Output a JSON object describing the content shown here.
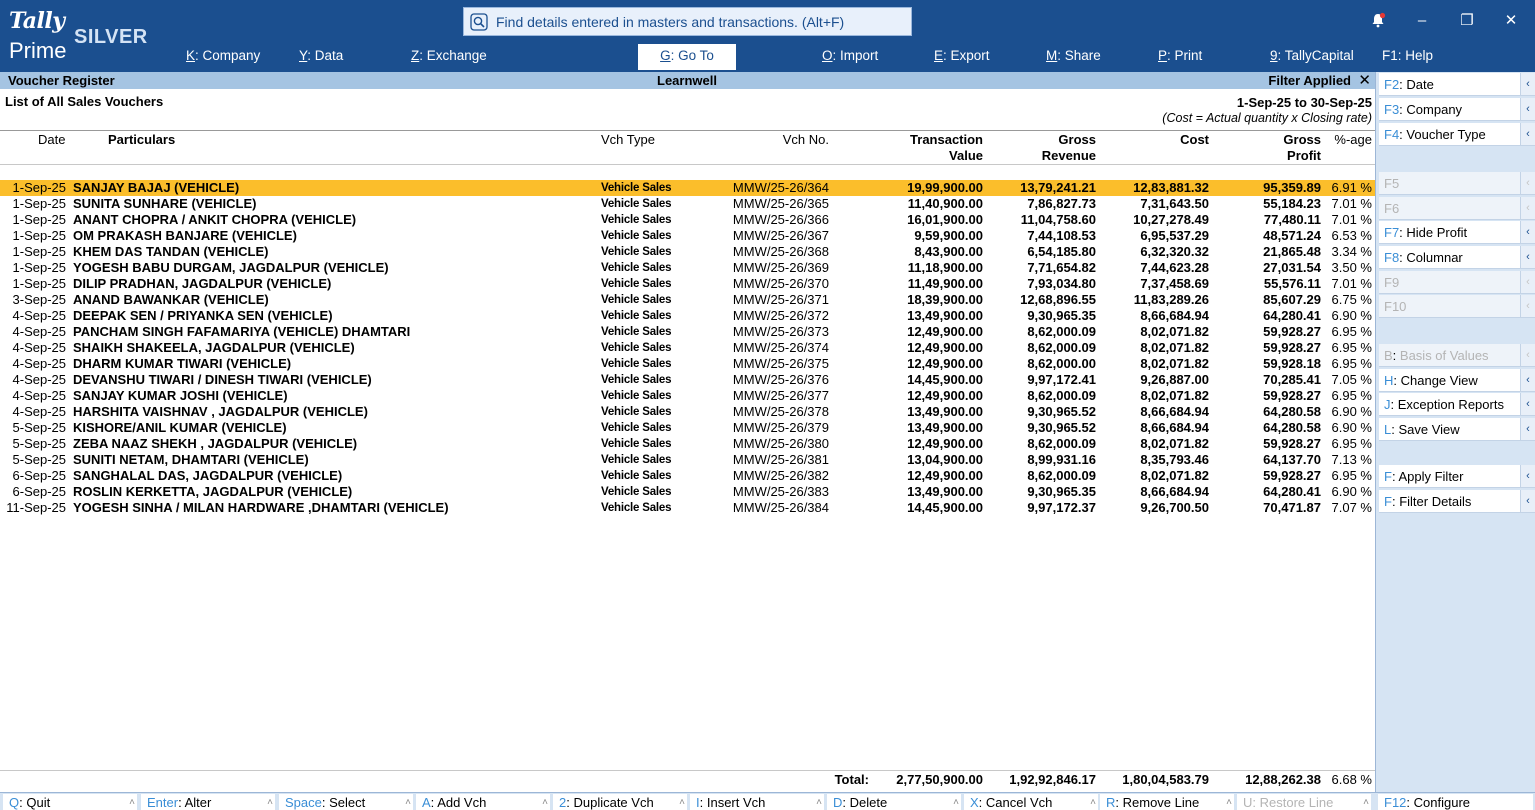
{
  "app": {
    "logo_line1": "Tally",
    "logo_line2": "Prime",
    "edition": "SILVER",
    "search_placeholder": "Find details entered in masters and transactions. (Alt+F)"
  },
  "menu": [
    {
      "key": "K",
      "label": "Company"
    },
    {
      "key": "Y",
      "label": "Data"
    },
    {
      "key": "Z",
      "label": "Exchange"
    },
    {
      "key": "G",
      "label": "Go To"
    },
    {
      "key": "O",
      "label": "Import"
    },
    {
      "key": "E",
      "label": "Export"
    },
    {
      "key": "M",
      "label": "Share"
    },
    {
      "key": "P",
      "label": "Print"
    },
    {
      "key": "9",
      "label": "TallyCapital"
    },
    {
      "key": "F1",
      "label": "Help"
    }
  ],
  "report": {
    "name": "Voucher Register",
    "company": "Learnwell",
    "filter_status": "Filter Applied",
    "title": "List of All Sales Vouchers",
    "period": "1-Sep-25 to 30-Sep-25",
    "cost_note": "(Cost = Actual quantity x Closing rate)"
  },
  "columns": {
    "date": "Date",
    "particulars": "Particulars",
    "vch_type": "Vch Type",
    "vch_no": "Vch No.",
    "transaction_value_1": "Transaction",
    "transaction_value_2": "Value",
    "gross_revenue_1": "Gross",
    "gross_revenue_2": "Revenue",
    "cost": "Cost",
    "gross_profit_1": "Gross",
    "gross_profit_2": "Profit",
    "pct": "%-age"
  },
  "rows": [
    {
      "date": "1-Sep-25",
      "particulars": "SANJAY BAJAJ (VEHICLE)",
      "vch_type": "Vehicle Sales",
      "vch_no": "MMW/25-26/364",
      "tv": "19,99,900.00",
      "gr": "13,79,241.21",
      "cost": "12,83,881.32",
      "gp": "95,359.89",
      "pct": "6.91 %"
    },
    {
      "date": "1-Sep-25",
      "particulars": "SUNITA SUNHARE (VEHICLE)",
      "vch_type": "Vehicle Sales",
      "vch_no": "MMW/25-26/365",
      "tv": "11,40,900.00",
      "gr": "7,86,827.73",
      "cost": "7,31,643.50",
      "gp": "55,184.23",
      "pct": "7.01 %"
    },
    {
      "date": "1-Sep-25",
      "particulars": "ANANT CHOPRA / ANKIT CHOPRA (VEHICLE)",
      "vch_type": "Vehicle Sales",
      "vch_no": "MMW/25-26/366",
      "tv": "16,01,900.00",
      "gr": "11,04,758.60",
      "cost": "10,27,278.49",
      "gp": "77,480.11",
      "pct": "7.01 %"
    },
    {
      "date": "1-Sep-25",
      "particulars": "OM PRAKASH BANJARE (VEHICLE)",
      "vch_type": "Vehicle Sales",
      "vch_no": "MMW/25-26/367",
      "tv": "9,59,900.00",
      "gr": "7,44,108.53",
      "cost": "6,95,537.29",
      "gp": "48,571.24",
      "pct": "6.53 %"
    },
    {
      "date": "1-Sep-25",
      "particulars": "KHEM DAS TANDAN (VEHICLE)",
      "vch_type": "Vehicle Sales",
      "vch_no": "MMW/25-26/368",
      "tv": "8,43,900.00",
      "gr": "6,54,185.80",
      "cost": "6,32,320.32",
      "gp": "21,865.48",
      "pct": "3.34 %"
    },
    {
      "date": "1-Sep-25",
      "particulars": "YOGESH BABU DURGAM, JAGDALPUR (VEHICLE)",
      "vch_type": "Vehicle Sales",
      "vch_no": "MMW/25-26/369",
      "tv": "11,18,900.00",
      "gr": "7,71,654.82",
      "cost": "7,44,623.28",
      "gp": "27,031.54",
      "pct": "3.50 %"
    },
    {
      "date": "1-Sep-25",
      "particulars": "DILIP PRADHAN, JAGDALPUR (VEHICLE)",
      "vch_type": "Vehicle Sales",
      "vch_no": "MMW/25-26/370",
      "tv": "11,49,900.00",
      "gr": "7,93,034.80",
      "cost": "7,37,458.69",
      "gp": "55,576.11",
      "pct": "7.01 %"
    },
    {
      "date": "3-Sep-25",
      "particulars": "ANAND BAWANKAR (VEHICLE)",
      "vch_type": "Vehicle Sales",
      "vch_no": "MMW/25-26/371",
      "tv": "18,39,900.00",
      "gr": "12,68,896.55",
      "cost": "11,83,289.26",
      "gp": "85,607.29",
      "pct": "6.75 %"
    },
    {
      "date": "4-Sep-25",
      "particulars": "DEEPAK SEN / PRIYANKA SEN (VEHICLE)",
      "vch_type": "Vehicle Sales",
      "vch_no": "MMW/25-26/372",
      "tv": "13,49,900.00",
      "gr": "9,30,965.35",
      "cost": "8,66,684.94",
      "gp": "64,280.41",
      "pct": "6.90 %"
    },
    {
      "date": "4-Sep-25",
      "particulars": "PANCHAM SINGH FAFAMARIYA (VEHICLE) DHAMTARI",
      "vch_type": "Vehicle Sales",
      "vch_no": "MMW/25-26/373",
      "tv": "12,49,900.00",
      "gr": "8,62,000.09",
      "cost": "8,02,071.82",
      "gp": "59,928.27",
      "pct": "6.95 %"
    },
    {
      "date": "4-Sep-25",
      "particulars": "SHAIKH SHAKEELA, JAGDALPUR (VEHICLE)",
      "vch_type": "Vehicle Sales",
      "vch_no": "MMW/25-26/374",
      "tv": "12,49,900.00",
      "gr": "8,62,000.09",
      "cost": "8,02,071.82",
      "gp": "59,928.27",
      "pct": "6.95 %"
    },
    {
      "date": "4-Sep-25",
      "particulars": "DHARM KUMAR TIWARI (VEHICLE)",
      "vch_type": "Vehicle Sales",
      "vch_no": "MMW/25-26/375",
      "tv": "12,49,900.00",
      "gr": "8,62,000.00",
      "cost": "8,02,071.82",
      "gp": "59,928.18",
      "pct": "6.95 %"
    },
    {
      "date": "4-Sep-25",
      "particulars": "DEVANSHU TIWARI / DINESH TIWARI (VEHICLE)",
      "vch_type": "Vehicle Sales",
      "vch_no": "MMW/25-26/376",
      "tv": "14,45,900.00",
      "gr": "9,97,172.41",
      "cost": "9,26,887.00",
      "gp": "70,285.41",
      "pct": "7.05 %"
    },
    {
      "date": "4-Sep-25",
      "particulars": "SANJAY KUMAR JOSHI (VEHICLE)",
      "vch_type": "Vehicle Sales",
      "vch_no": "MMW/25-26/377",
      "tv": "12,49,900.00",
      "gr": "8,62,000.09",
      "cost": "8,02,071.82",
      "gp": "59,928.27",
      "pct": "6.95 %"
    },
    {
      "date": "4-Sep-25",
      "particulars": "HARSHITA VAISHNAV , JAGDALPUR (VEHICLE)",
      "vch_type": "Vehicle Sales",
      "vch_no": "MMW/25-26/378",
      "tv": "13,49,900.00",
      "gr": "9,30,965.52",
      "cost": "8,66,684.94",
      "gp": "64,280.58",
      "pct": "6.90 %"
    },
    {
      "date": "5-Sep-25",
      "particulars": "KISHORE/ANIL KUMAR (VEHICLE)",
      "vch_type": "Vehicle Sales",
      "vch_no": "MMW/25-26/379",
      "tv": "13,49,900.00",
      "gr": "9,30,965.52",
      "cost": "8,66,684.94",
      "gp": "64,280.58",
      "pct": "6.90 %"
    },
    {
      "date": "5-Sep-25",
      "particulars": "ZEBA NAAZ SHEKH , JAGDALPUR (VEHICLE)",
      "vch_type": "Vehicle Sales",
      "vch_no": "MMW/25-26/380",
      "tv": "12,49,900.00",
      "gr": "8,62,000.09",
      "cost": "8,02,071.82",
      "gp": "59,928.27",
      "pct": "6.95 %"
    },
    {
      "date": "5-Sep-25",
      "particulars": "SUNITI NETAM, DHAMTARI (VEHICLE)",
      "vch_type": "Vehicle Sales",
      "vch_no": "MMW/25-26/381",
      "tv": "13,04,900.00",
      "gr": "8,99,931.16",
      "cost": "8,35,793.46",
      "gp": "64,137.70",
      "pct": "7.13 %"
    },
    {
      "date": "6-Sep-25",
      "particulars": "SANGHALAL DAS, JAGDALPUR (VEHICLE)",
      "vch_type": "Vehicle Sales",
      "vch_no": "MMW/25-26/382",
      "tv": "12,49,900.00",
      "gr": "8,62,000.09",
      "cost": "8,02,071.82",
      "gp": "59,928.27",
      "pct": "6.95 %"
    },
    {
      "date": "6-Sep-25",
      "particulars": "ROSLIN KERKETTA, JAGDALPUR (VEHICLE)",
      "vch_type": "Vehicle Sales",
      "vch_no": "MMW/25-26/383",
      "tv": "13,49,900.00",
      "gr": "9,30,965.35",
      "cost": "8,66,684.94",
      "gp": "64,280.41",
      "pct": "6.90 %"
    },
    {
      "date": "11-Sep-25",
      "particulars": "YOGESH SINHA / MILAN HARDWARE ,DHAMTARI (VEHICLE)",
      "vch_type": "Vehicle Sales",
      "vch_no": "MMW/25-26/384",
      "tv": "14,45,900.00",
      "gr": "9,97,172.37",
      "cost": "9,26,700.50",
      "gp": "70,471.87",
      "pct": "7.07 %"
    }
  ],
  "totals": {
    "label": "Total:",
    "tv": "2,77,50,900.00",
    "gr": "1,92,92,846.17",
    "cost": "1,80,04,583.79",
    "gp": "12,88,262.38",
    "pct": "6.68 %"
  },
  "side": [
    {
      "key": "F2",
      "label": "Date",
      "enabled": true
    },
    {
      "key": "F3",
      "label": "Company",
      "enabled": true
    },
    {
      "key": "F4",
      "label": "Voucher Type",
      "enabled": true
    },
    {
      "key": "F5",
      "label": "",
      "enabled": false
    },
    {
      "key": "F6",
      "label": "",
      "enabled": false
    },
    {
      "key": "F7",
      "label": "Hide Profit",
      "enabled": true
    },
    {
      "key": "F8",
      "label": "Columnar",
      "enabled": true
    },
    {
      "key": "F9",
      "label": "",
      "enabled": false
    },
    {
      "key": "F10",
      "label": "",
      "enabled": false
    },
    {
      "key": "B",
      "label": "Basis of Values",
      "enabled": false
    },
    {
      "key": "H",
      "label": "Change View",
      "enabled": true
    },
    {
      "key": "J",
      "label": "Exception Reports",
      "enabled": true
    },
    {
      "key": "L",
      "label": "Save View",
      "enabled": true
    },
    {
      "key": "F",
      "label": "Apply Filter",
      "enabled": true
    },
    {
      "key": "F",
      "label": "Filter Details",
      "enabled": true
    }
  ],
  "bottom": [
    {
      "key": "Q",
      "label": "Quit",
      "enabled": true
    },
    {
      "key": "Enter",
      "label": "Alter",
      "enabled": true
    },
    {
      "key": "Space",
      "label": "Select",
      "enabled": true
    },
    {
      "key": "A",
      "label": "Add Vch",
      "enabled": true
    },
    {
      "key": "2",
      "label": "Duplicate Vch",
      "enabled": true
    },
    {
      "key": "I",
      "label": "Insert Vch",
      "enabled": true
    },
    {
      "key": "D",
      "label": "Delete",
      "enabled": true
    },
    {
      "key": "X",
      "label": "Cancel Vch",
      "enabled": true
    },
    {
      "key": "R",
      "label": "Remove Line",
      "enabled": true
    },
    {
      "key": "U",
      "label": "Restore Line",
      "enabled": false
    },
    {
      "key": "F12",
      "label": "Configure",
      "enabled": true
    }
  ],
  "colors": {
    "titlebar": "#1b4f8f",
    "header_strip": "#a5c4e2",
    "selected_row": "#fbbe2b",
    "side_panel": "#d6e4f3",
    "key_highlight": "#3a8ed6"
  }
}
